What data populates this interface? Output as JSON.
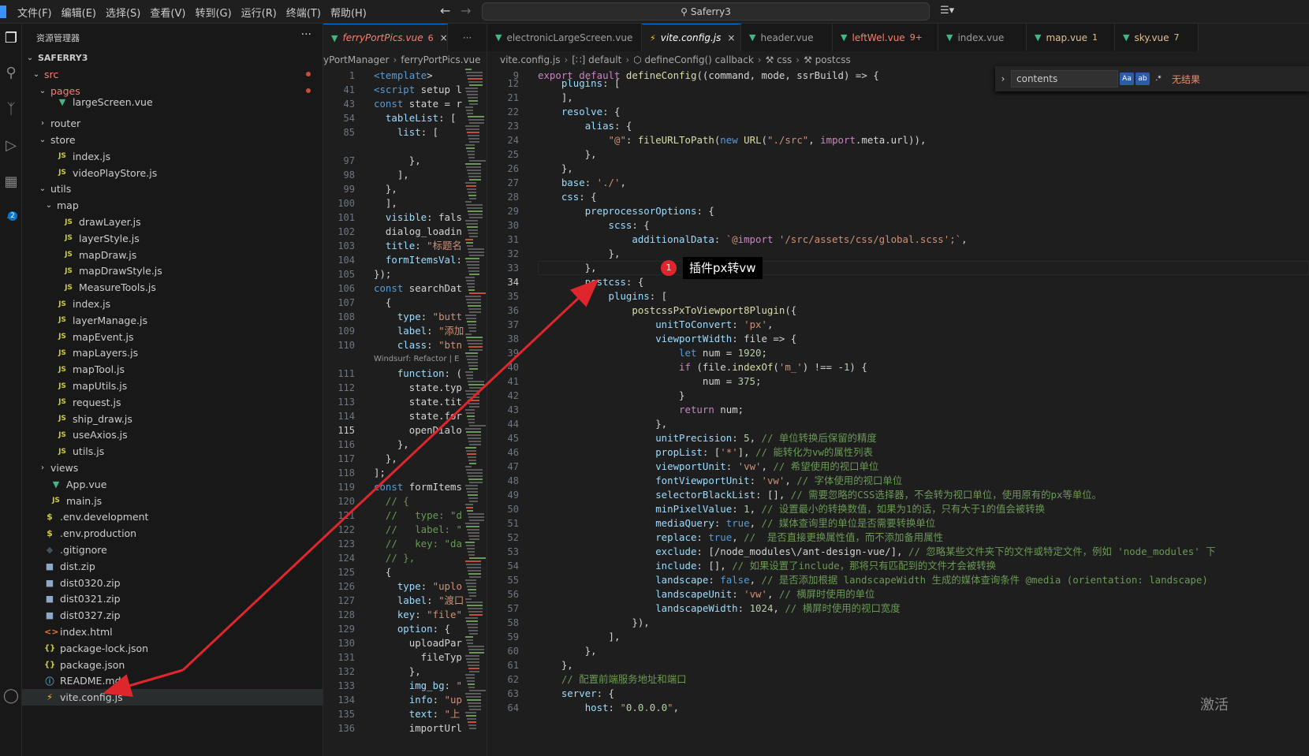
{
  "titlebar": {
    "menus": [
      "文件(F)",
      "编辑(E)",
      "选择(S)",
      "查看(V)",
      "转到(G)",
      "运行(R)",
      "终端(T)",
      "帮助(H)"
    ],
    "search": "Saferry3",
    "copilot": "☰▾"
  },
  "sidebar": {
    "title": "资源管理器",
    "more": "···",
    "tree": [
      {
        "indent": 0,
        "chev": "⌄",
        "icon": "",
        "name": "SAFERRY3",
        "root": true
      },
      {
        "indent": 1,
        "chev": "⌄",
        "icon": "",
        "name": "src",
        "err": true,
        "dot": true
      },
      {
        "indent": 2,
        "chev": "⌄",
        "icon": "",
        "name": "pages",
        "err": true,
        "dot": true
      },
      {
        "indent": 3,
        "chev": "",
        "icon": "vue",
        "name": "largeScreen.vue",
        "partial": true
      },
      {
        "indent": 2,
        "chev": "›",
        "icon": "",
        "name": "router"
      },
      {
        "indent": 2,
        "chev": "⌄",
        "icon": "",
        "name": "store"
      },
      {
        "indent": 3,
        "chev": "",
        "icon": "js",
        "name": "index.js"
      },
      {
        "indent": 3,
        "chev": "",
        "icon": "js",
        "name": "videoPlayStore.js"
      },
      {
        "indent": 2,
        "chev": "⌄",
        "icon": "",
        "name": "utils"
      },
      {
        "indent": 3,
        "chev": "⌄",
        "icon": "",
        "name": "map"
      },
      {
        "indent": 4,
        "chev": "",
        "icon": "js",
        "name": "drawLayer.js"
      },
      {
        "indent": 4,
        "chev": "",
        "icon": "js",
        "name": "layerStyle.js"
      },
      {
        "indent": 4,
        "chev": "",
        "icon": "js",
        "name": "mapDraw.js"
      },
      {
        "indent": 4,
        "chev": "",
        "icon": "js",
        "name": "mapDrawStyle.js"
      },
      {
        "indent": 4,
        "chev": "",
        "icon": "js",
        "name": "MeasureTools.js"
      },
      {
        "indent": 3,
        "chev": "",
        "icon": "js",
        "name": "index.js"
      },
      {
        "indent": 3,
        "chev": "",
        "icon": "js",
        "name": "layerManage.js"
      },
      {
        "indent": 3,
        "chev": "",
        "icon": "js",
        "name": "mapEvent.js"
      },
      {
        "indent": 3,
        "chev": "",
        "icon": "js",
        "name": "mapLayers.js"
      },
      {
        "indent": 3,
        "chev": "",
        "icon": "js",
        "name": "mapTool.js"
      },
      {
        "indent": 3,
        "chev": "",
        "icon": "js",
        "name": "mapUtils.js"
      },
      {
        "indent": 3,
        "chev": "",
        "icon": "js",
        "name": "request.js"
      },
      {
        "indent": 3,
        "chev": "",
        "icon": "js",
        "name": "ship_draw.js"
      },
      {
        "indent": 3,
        "chev": "",
        "icon": "js",
        "name": "useAxios.js"
      },
      {
        "indent": 3,
        "chev": "",
        "icon": "js",
        "name": "utils.js"
      },
      {
        "indent": 2,
        "chev": "›",
        "icon": "",
        "name": "views"
      },
      {
        "indent": 2,
        "chev": "",
        "icon": "vue",
        "name": "App.vue"
      },
      {
        "indent": 2,
        "chev": "",
        "icon": "js",
        "name": "main.js"
      },
      {
        "indent": 1,
        "chev": "",
        "icon": "env",
        "name": ".env.development"
      },
      {
        "indent": 1,
        "chev": "",
        "icon": "env",
        "name": ".env.production"
      },
      {
        "indent": 1,
        "chev": "",
        "icon": "git",
        "name": ".gitignore"
      },
      {
        "indent": 1,
        "chev": "",
        "icon": "zip",
        "name": "dist.zip"
      },
      {
        "indent": 1,
        "chev": "",
        "icon": "zip",
        "name": "dist0320.zip"
      },
      {
        "indent": 1,
        "chev": "",
        "icon": "zip",
        "name": "dist0321.zip"
      },
      {
        "indent": 1,
        "chev": "",
        "icon": "zip",
        "name": "dist0327.zip"
      },
      {
        "indent": 1,
        "chev": "",
        "icon": "html",
        "name": "index.html"
      },
      {
        "indent": 1,
        "chev": "",
        "icon": "json",
        "name": "package-lock.json"
      },
      {
        "indent": 1,
        "chev": "",
        "icon": "json",
        "name": "package.json"
      },
      {
        "indent": 1,
        "chev": "",
        "icon": "md",
        "name": "README.md"
      },
      {
        "indent": 1,
        "chev": "",
        "icon": "vite",
        "name": "vite.config.js",
        "selected": true
      }
    ]
  },
  "icons": {
    "js": "JS",
    "vue": "▼",
    "env": "$",
    "git": "◆",
    "zip": "■",
    "html": "<>",
    "json": "{}",
    "md": "ⓘ",
    "vite": "⚡"
  },
  "left_editor": {
    "tab": {
      "label": "ferryPortPics.vue",
      "count": "6",
      "close": "×"
    },
    "tab_more": "···",
    "breadcrumb": [
      "yPortManager",
      "ferryPortPics.vue"
    ],
    "codelens": "Windsurf: Refactor | E",
    "lines": [
      {
        "n": "1",
        "t": "<template>"
      },
      {
        "n": "41",
        "t": "<script setup l"
      },
      {
        "n": "43",
        "t": "const state = r"
      },
      {
        "n": "54",
        "t": "  tableList: ["
      },
      {
        "n": "85",
        "t": "    list: ["
      },
      {
        "n": "",
        "t": "      "
      },
      {
        "n": "97",
        "t": "      },"
      },
      {
        "n": "98",
        "t": "    ],"
      },
      {
        "n": "99",
        "t": "  },"
      },
      {
        "n": "100",
        "t": "  ],"
      },
      {
        "n": "101",
        "t": "  visible: fals"
      },
      {
        "n": "102",
        "t": "  dialog_loadin"
      },
      {
        "n": "103",
        "t": "  title: \"标题名"
      },
      {
        "n": "104",
        "t": "  formItemsVal:"
      },
      {
        "n": "105",
        "t": "});"
      },
      {
        "n": "106",
        "t": "const searchDat"
      },
      {
        "n": "107",
        "t": "  {"
      },
      {
        "n": "108",
        "t": "    type: \"butt"
      },
      {
        "n": "109",
        "t": "    label: \"添加"
      },
      {
        "n": "110",
        "t": "    class: \"btn"
      },
      {
        "n": "111",
        "t": "    function: ("
      },
      {
        "n": "112",
        "t": "      state.typ"
      },
      {
        "n": "113",
        "t": "      state.tit"
      },
      {
        "n": "114",
        "t": "      state.for"
      },
      {
        "n": "115",
        "t": "      openDialo"
      },
      {
        "n": "116",
        "t": "    },"
      },
      {
        "n": "117",
        "t": "  },"
      },
      {
        "n": "118",
        "t": "];"
      },
      {
        "n": "119",
        "t": "const formItems"
      },
      {
        "n": "120",
        "t": "  // {"
      },
      {
        "n": "121",
        "t": "  //   type: \"d"
      },
      {
        "n": "122",
        "t": "  //   label: \""
      },
      {
        "n": "123",
        "t": "  //   key: \"da"
      },
      {
        "n": "124",
        "t": "  // },"
      },
      {
        "n": "125",
        "t": "  {"
      },
      {
        "n": "126",
        "t": "    type: \"uplo"
      },
      {
        "n": "127",
        "t": "    label: \"渡口"
      },
      {
        "n": "128",
        "t": "    key: \"file\""
      },
      {
        "n": "129",
        "t": "    option: {"
      },
      {
        "n": "130",
        "t": "      uploadPar"
      },
      {
        "n": "131",
        "t": "        fileTyp"
      },
      {
        "n": "132",
        "t": "      },"
      },
      {
        "n": "133",
        "t": "      img_bg: \""
      },
      {
        "n": "134",
        "t": "      info: \"up"
      },
      {
        "n": "135",
        "t": "      text: \"上"
      },
      {
        "n": "136",
        "t": "      importUrl"
      }
    ]
  },
  "right_editor": {
    "tabs": [
      {
        "label": "electronicLargeScreen.vue",
        "icon": "vue"
      },
      {
        "label": "vite.config.js",
        "icon": "vite",
        "active": true,
        "close": "×"
      },
      {
        "label": "header.vue",
        "icon": "vue"
      },
      {
        "label": "leftWel.vue",
        "icon": "vue",
        "state": "err",
        "count": "9+"
      },
      {
        "label": "index.vue",
        "icon": "vue"
      },
      {
        "label": "map.vue",
        "icon": "vue",
        "state": "warn",
        "count": "1"
      },
      {
        "label": "sky.vue",
        "icon": "vue",
        "state": "warn",
        "count": "7"
      }
    ],
    "breadcrumb": [
      "vite.config.js",
      "[∷] default",
      "⬡ defineConfig() callback",
      "⚒ css",
      "⚒ postcss"
    ],
    "find": {
      "value": "contents",
      "opt1": "Aa",
      "opt2": "ab",
      "opt3": ".*",
      "result": "无结果"
    },
    "sticky": {
      "n": "9",
      "t": "export default defineConfig((command, mode, ssrBuild) => {"
    },
    "lines": [
      {
        "n": "12",
        "t": "    plugins: ["
      },
      {
        "n": "21",
        "t": "    ],"
      },
      {
        "n": "22",
        "t": "    resolve: {"
      },
      {
        "n": "23",
        "t": "        alias: {"
      },
      {
        "n": "24",
        "t": "            \"@\": fileURLToPath(new URL(\"./src\", import.meta.url)),"
      },
      {
        "n": "25",
        "t": "        },"
      },
      {
        "n": "26",
        "t": "    },"
      },
      {
        "n": "27",
        "t": "    base: './',"
      },
      {
        "n": "28",
        "t": "    css: {"
      },
      {
        "n": "29",
        "t": "        preprocessorOptions: {"
      },
      {
        "n": "30",
        "t": "            scss: {"
      },
      {
        "n": "31",
        "t": "                additionalData: `@import '/src/assets/css/global.scss';`,"
      },
      {
        "n": "32",
        "t": "            },"
      },
      {
        "n": "33",
        "t": "        },"
      },
      {
        "n": "34",
        "t": "        postcss: {"
      },
      {
        "n": "35",
        "t": "            plugins: ["
      },
      {
        "n": "36",
        "t": "                postcssPxToViewport8Plugin({"
      },
      {
        "n": "37",
        "t": "                    unitToConvert: 'px',"
      },
      {
        "n": "38",
        "t": "                    viewportWidth: file => {"
      },
      {
        "n": "39",
        "t": "                        let num = 1920;"
      },
      {
        "n": "40",
        "t": "                        if (file.indexOf('m_') !== -1) {"
      },
      {
        "n": "41",
        "t": "                            num = 375;"
      },
      {
        "n": "42",
        "t": "                        }"
      },
      {
        "n": "43",
        "t": "                        return num;"
      },
      {
        "n": "44",
        "t": "                    },"
      },
      {
        "n": "45",
        "t": "                    unitPrecision: 5, // 单位转换后保留的精度"
      },
      {
        "n": "46",
        "t": "                    propList: ['*'], // 能转化为vw的属性列表"
      },
      {
        "n": "47",
        "t": "                    viewportUnit: 'vw', // 希望使用的视口单位"
      },
      {
        "n": "48",
        "t": "                    fontViewportUnit: 'vw', // 字体使用的视口单位"
      },
      {
        "n": "49",
        "t": "                    selectorBlackList: [], // 需要忽略的CSS选择器，不会转为视口单位，使用原有的px等单位。"
      },
      {
        "n": "50",
        "t": "                    minPixelValue: 1, // 设置最小的转换数值，如果为1的话，只有大于1的值会被转换"
      },
      {
        "n": "51",
        "t": "                    mediaQuery: true, // 媒体查询里的单位是否需要转换单位"
      },
      {
        "n": "52",
        "t": "                    replace: true, //  是否直接更换属性值，而不添加备用属性"
      },
      {
        "n": "53",
        "t": "                    exclude: [/node_modules\\/ant-design-vue/], // 忽略某些文件夹下的文件或特定文件，例如 'node_modules' 下"
      },
      {
        "n": "54",
        "t": "                    include: [], // 如果设置了include，那将只有匹配到的文件才会被转换"
      },
      {
        "n": "55",
        "t": "                    landscape: false, // 是否添加根据 landscapeWidth 生成的媒体查询条件 @media (orientation: landscape)"
      },
      {
        "n": "56",
        "t": "                    landscapeUnit: 'vw', // 横屏时使用的单位"
      },
      {
        "n": "57",
        "t": "                    landscapeWidth: 1024, // 横屏时使用的视口宽度"
      },
      {
        "n": "58",
        "t": "                }),"
      },
      {
        "n": "59",
        "t": "            ],"
      },
      {
        "n": "60",
        "t": "        },"
      },
      {
        "n": "61",
        "t": "    },"
      },
      {
        "n": "62",
        "t": "    // 配置前端服务地址和端口"
      },
      {
        "n": "63",
        "t": "    server: {"
      },
      {
        "n": "64",
        "t": "        host: \"0.0.0.0\","
      }
    ]
  },
  "annotation": {
    "badge": "1",
    "label": "插件px转vw",
    "color": "#e0262d"
  },
  "watermark": "激活"
}
